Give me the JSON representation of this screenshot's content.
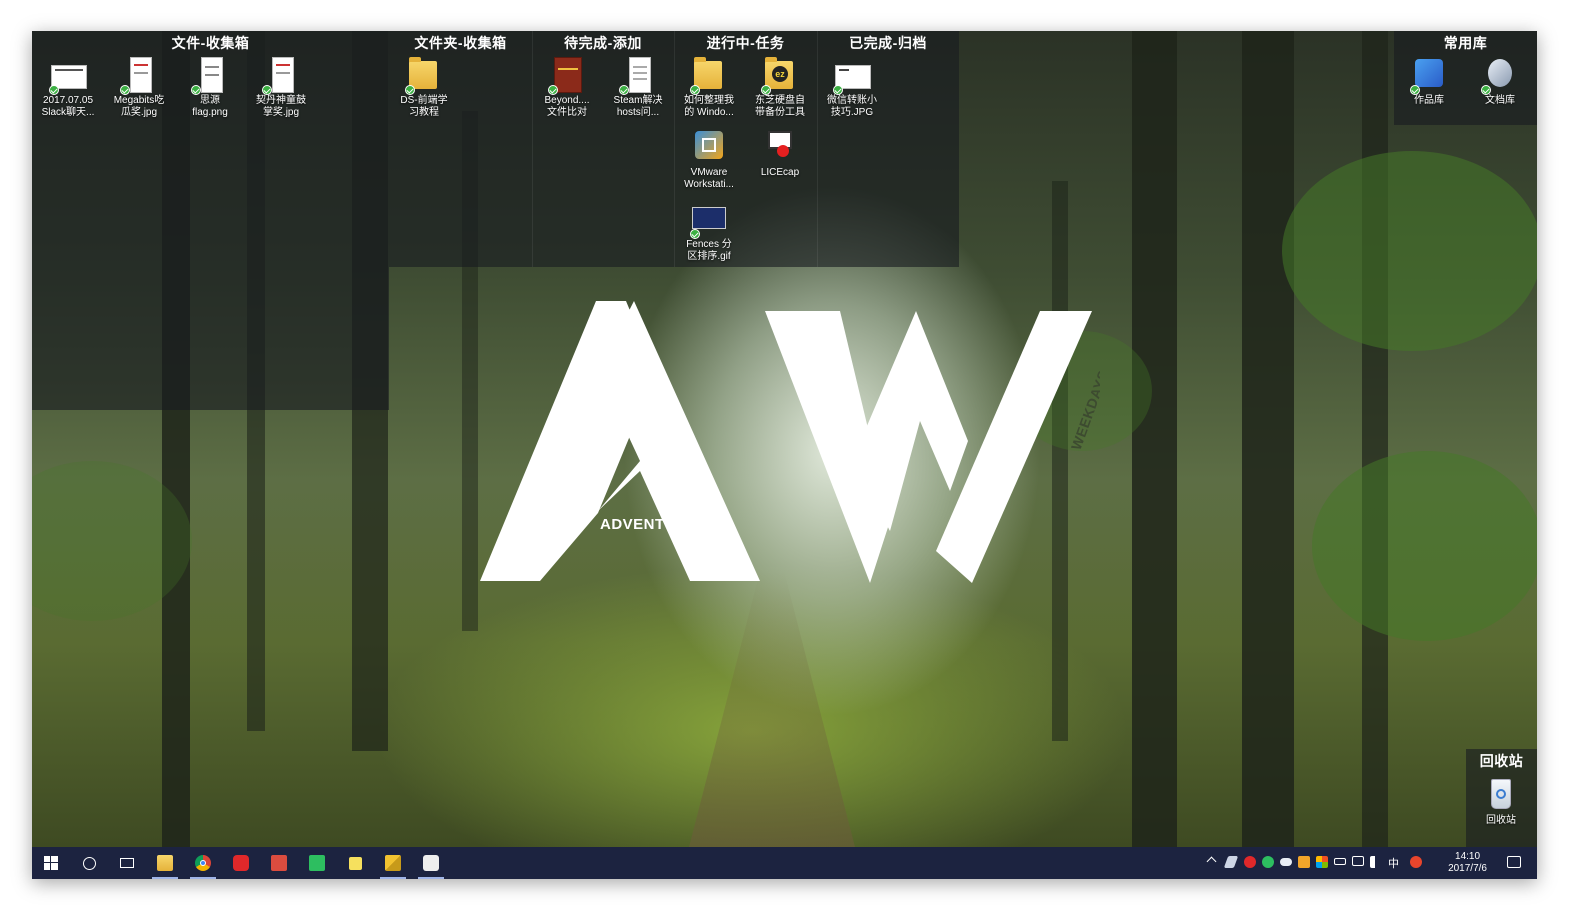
{
  "fences": {
    "files_inbox": {
      "title": "文件-收集箱",
      "items": [
        {
          "label": "2017.07.05\nSlack聊天..."
        },
        {
          "label": "Megabits吃\n瓜奖.jpg"
        },
        {
          "label": "思源\nflag.png"
        },
        {
          "label": "契丹神童鼓\n掌奖.jpg"
        }
      ]
    },
    "folders_inbox": {
      "title": "文件夹-收集箱",
      "items": [
        {
          "label": "DS-前端学\n习教程"
        }
      ]
    },
    "todo": {
      "title": "待完成-添加",
      "items": [
        {
          "label": "Beyond....\n文件比对"
        },
        {
          "label": "Steam解决\nhosts问..."
        }
      ]
    },
    "in_progress": {
      "title": "进行中-任务",
      "items": [
        {
          "label": "如何整理我\n的 Windo..."
        },
        {
          "label": "东芝硬盘自\n带备份工具"
        },
        {
          "label": "VMware\nWorkstati..."
        },
        {
          "label": "LICEcap"
        },
        {
          "label": "Fences 分\n区排序.gif"
        }
      ]
    },
    "done": {
      "title": "已完成-归档",
      "items": [
        {
          "label": "微信转账小\n技巧.JPG"
        }
      ]
    },
    "common": {
      "title": "常用库",
      "items": [
        {
          "label": "作品库"
        },
        {
          "label": "文档库"
        }
      ]
    },
    "recycle": {
      "title": "回收站",
      "items": [
        {
          "label": "回收站"
        }
      ]
    }
  },
  "logo": {
    "letters": "AW",
    "word_left": "ADVENTURE",
    "word_right": "WEEKDAYS"
  },
  "taskbar": {
    "apps": [
      "windows-start-icon",
      "cortana-icon",
      "task-view-icon",
      "file-explorer-icon",
      "chrome-icon",
      "netease-music-icon",
      "todoist-icon",
      "evernote-icon",
      "sticky-notes-icon",
      "fences-app-icon",
      "inkscape-icon"
    ],
    "tray": {
      "ime": "中",
      "time": "14:10",
      "date": "2017/7/6"
    }
  },
  "colors": {
    "taskbar": "#1c2340",
    "fence_bg": "rgba(25,28,32,0.62)",
    "sync_badge": "#3cb043"
  }
}
